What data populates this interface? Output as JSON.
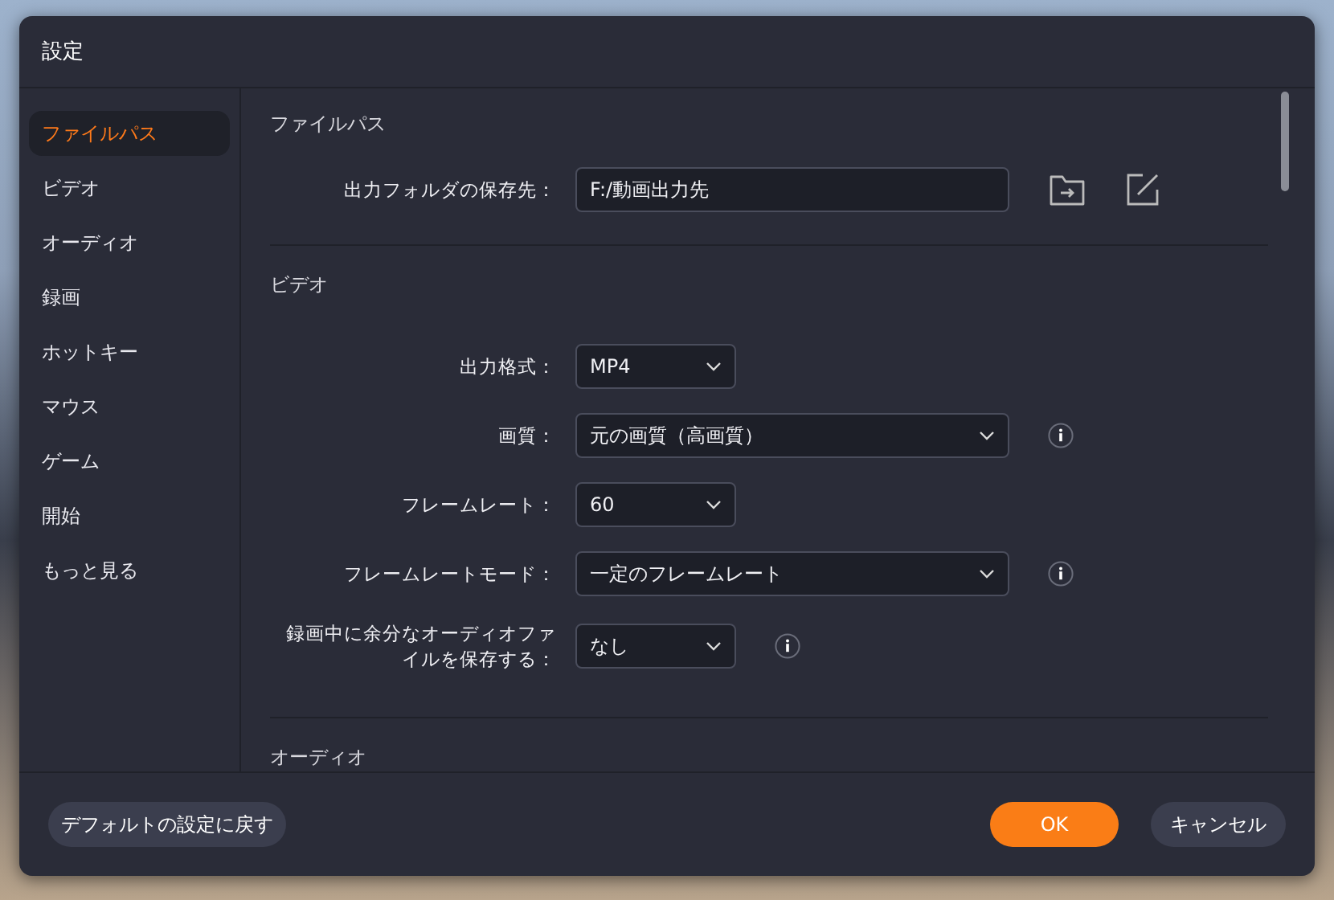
{
  "window": {
    "title": "設定"
  },
  "sidebar": {
    "items": [
      {
        "label": "ファイルパス",
        "selected": true
      },
      {
        "label": "ビデオ",
        "selected": false
      },
      {
        "label": "オーディオ",
        "selected": false
      },
      {
        "label": "録画",
        "selected": false
      },
      {
        "label": "ホットキー",
        "selected": false
      },
      {
        "label": "マウス",
        "selected": false
      },
      {
        "label": "ゲーム",
        "selected": false
      },
      {
        "label": "開始",
        "selected": false
      },
      {
        "label": "もっと見る",
        "selected": false
      }
    ]
  },
  "sections": [
    {
      "title": "ファイルパス",
      "rows": [
        {
          "kind": "path",
          "label": "出力フォルダの保存先：",
          "value": "F:/動画出力先",
          "info": false
        }
      ]
    },
    {
      "title": "ビデオ",
      "rows": [
        {
          "kind": "short-select",
          "label": "出力格式：",
          "value": "MP4",
          "info": false
        },
        {
          "kind": "long-select",
          "label": "画質：",
          "value": "元の画質（高画質）",
          "info": true
        },
        {
          "kind": "short-select",
          "label": "フレームレート：",
          "value": "60",
          "info": false
        },
        {
          "kind": "long-select",
          "label": "フレームレートモード：",
          "value": "一定のフレームレート",
          "info": true
        },
        {
          "kind": "short-select",
          "label": "録画中に余分なオーディオファイルを保存する：",
          "value": "なし",
          "info": true
        }
      ]
    },
    {
      "title": "オーディオ"
    }
  ],
  "footer": {
    "reset": "デフォルトの設定に戻す",
    "ok": "OK",
    "cancel": "キャンセル"
  }
}
